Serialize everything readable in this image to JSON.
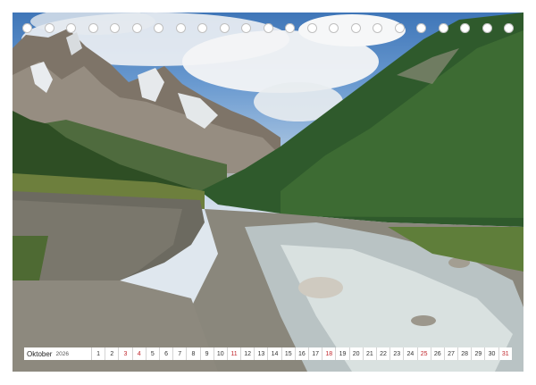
{
  "calendar": {
    "month": "Oktober",
    "year": "2026",
    "days": [
      {
        "n": "1",
        "sun": false
      },
      {
        "n": "2",
        "sun": false
      },
      {
        "n": "3",
        "sun": true
      },
      {
        "n": "4",
        "sun": true
      },
      {
        "n": "5",
        "sun": false
      },
      {
        "n": "6",
        "sun": false
      },
      {
        "n": "7",
        "sun": false
      },
      {
        "n": "8",
        "sun": false
      },
      {
        "n": "9",
        "sun": false
      },
      {
        "n": "10",
        "sun": false
      },
      {
        "n": "11",
        "sun": true
      },
      {
        "n": "12",
        "sun": false
      },
      {
        "n": "13",
        "sun": false
      },
      {
        "n": "14",
        "sun": false
      },
      {
        "n": "15",
        "sun": false
      },
      {
        "n": "16",
        "sun": false
      },
      {
        "n": "17",
        "sun": false
      },
      {
        "n": "18",
        "sun": true
      },
      {
        "n": "19",
        "sun": false
      },
      {
        "n": "20",
        "sun": false
      },
      {
        "n": "21",
        "sun": false
      },
      {
        "n": "22",
        "sun": false
      },
      {
        "n": "23",
        "sun": false
      },
      {
        "n": "24",
        "sun": false
      },
      {
        "n": "25",
        "sun": true
      },
      {
        "n": "26",
        "sun": false
      },
      {
        "n": "27",
        "sun": false
      },
      {
        "n": "28",
        "sun": false
      },
      {
        "n": "29",
        "sun": false
      },
      {
        "n": "30",
        "sun": false
      },
      {
        "n": "31",
        "sun": true
      }
    ]
  },
  "colors": {
    "sunday": "#c0262c",
    "weekday": "#333333",
    "hole": "#ffffff"
  },
  "binding": {
    "hole_count": 23,
    "icon": "binding-hole-icon"
  }
}
